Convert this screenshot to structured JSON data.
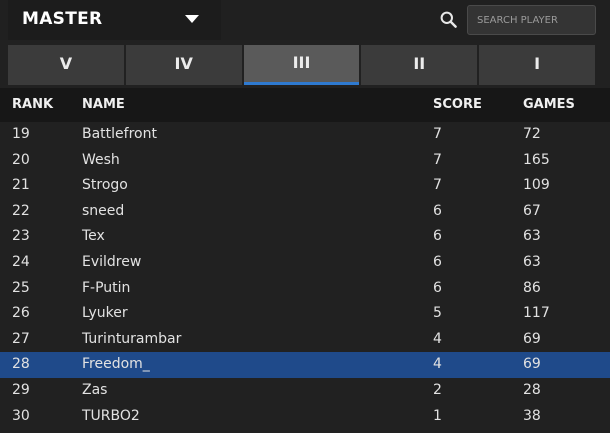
{
  "header": {
    "league_label": "MASTER",
    "search_placeholder": "SEARCH PLAYER"
  },
  "tabs": [
    {
      "label": "V",
      "active": false
    },
    {
      "label": "IV",
      "active": false
    },
    {
      "label": "III",
      "active": true
    },
    {
      "label": "II",
      "active": false
    },
    {
      "label": "I",
      "active": false
    }
  ],
  "table": {
    "columns": {
      "rank": "RANK",
      "name": "NAME",
      "score": "SCORE",
      "games": "GAMES"
    },
    "rows": [
      {
        "rank": "19",
        "name": "Battlefront",
        "score": "7",
        "games": "72"
      },
      {
        "rank": "20",
        "name": "Wesh",
        "score": "7",
        "games": "165"
      },
      {
        "rank": "21",
        "name": "Strogo",
        "score": "7",
        "games": "109"
      },
      {
        "rank": "22",
        "name": "sneed",
        "score": "6",
        "games": "67"
      },
      {
        "rank": "23",
        "name": "Tex",
        "score": "6",
        "games": "63"
      },
      {
        "rank": "24",
        "name": "Evildrew",
        "score": "6",
        "games": "63"
      },
      {
        "rank": "25",
        "name": "F-Putin",
        "score": "6",
        "games": "86"
      },
      {
        "rank": "26",
        "name": "Lyuker",
        "score": "5",
        "games": "117"
      },
      {
        "rank": "27",
        "name": "Turinturambar",
        "score": "4",
        "games": "69"
      },
      {
        "rank": "28",
        "name": "Freedom_",
        "score": "4",
        "games": "69",
        "selected": true
      },
      {
        "rank": "29",
        "name": "Zas",
        "score": "2",
        "games": "28"
      },
      {
        "rank": "30",
        "name": "TURBO2",
        "score": "1",
        "games": "38"
      }
    ]
  },
  "colors": {
    "accent": "#2f7ad0",
    "selected_row": "#1f4a8a",
    "background": "#212121"
  },
  "icons": {
    "league_dropdown": "chevron-down-icon",
    "search": "search-icon"
  }
}
